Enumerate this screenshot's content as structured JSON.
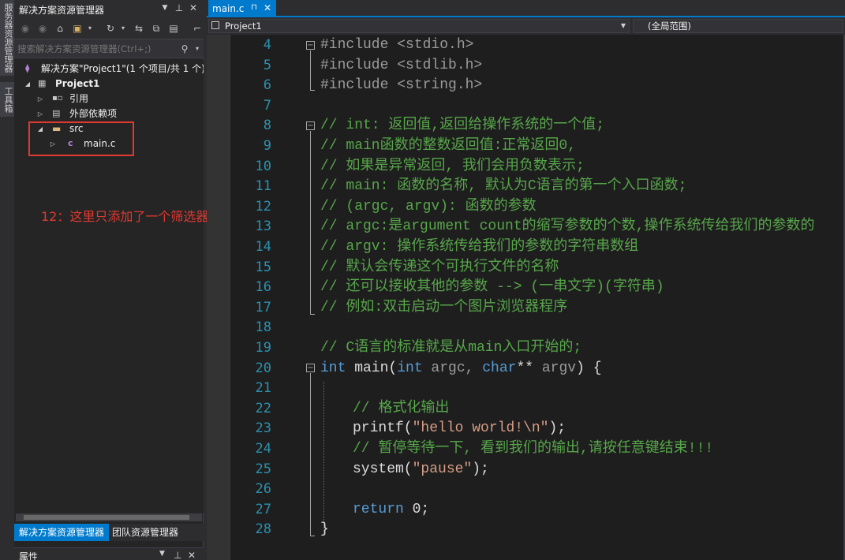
{
  "side_strip": {
    "tab1": "服务器资源管理器",
    "tab2": "工具箱"
  },
  "solution_explorer": {
    "title": "解决方案资源管理器",
    "search_placeholder": "搜索解决方案资源管理器(Ctrl+;)",
    "toolbar_icons": [
      "back-icon",
      "forward-icon",
      "home-icon",
      "switch-views-icon",
      "history-icon",
      "sync-icon",
      "collapse-all-icon",
      "show-all-files-icon",
      "properties-icon"
    ],
    "tree": {
      "solution": "解决方案\"Project1\"(1 个项目/共 1 个)",
      "project": "Project1",
      "references": "引用",
      "external_deps": "外部依赖项",
      "filter": "src",
      "file": "main.c"
    },
    "tabs": [
      "解决方案资源管理器",
      "团队资源管理器"
    ],
    "properties_title": "属性"
  },
  "annotation": {
    "note": "12：这里只添加了一个筛选器",
    "color": "#e0392f"
  },
  "editor": {
    "tab_name": "main.c",
    "pin_glyph": "⊓",
    "nav_project": "Project1",
    "nav_scope": "(全局范围)",
    "line_numbers": [
      "4",
      "5",
      "6",
      "7",
      "8",
      "9",
      "10",
      "11",
      "12",
      "13",
      "14",
      "15",
      "16",
      "17",
      "18",
      "19",
      "20",
      "21",
      "22",
      "23",
      "24",
      "25",
      "26",
      "27",
      "28"
    ],
    "code": {
      "l4": "#include <stdio.h>",
      "l5": "#include <stdlib.h>",
      "l6": "#include <string.h>",
      "l8": "// int: 返回值,返回给操作系统的一个值;",
      "l9": "// main函数的整数返回值:正常返回0,",
      "l10": "// 如果是异常返回, 我们会用负数表示;",
      "l11": "// main: 函数的名称, 默认为C语言的第一个入口函数;",
      "l12": "// (argc, argv): 函数的参数",
      "l13": "// argc:是argument count的缩写参数的个数,操作系统传给我们的参数的",
      "l14": "// argv: 操作系统传给我们的参数的字符串数组",
      "l15": "// 默认会传递这个可执行文件的名称",
      "l16": "// 还可以接收其他的参数 --> (一串文字)(字符串)",
      "l17": "// 例如:双击启动一个图片浏览器程序",
      "l19": "// C语言的标准就是从main入口开始的;",
      "l20_kw1": "int",
      "l20_fn": " main(",
      "l20_kw2": "int",
      "l20_p1": " argc, ",
      "l20_kw3": "char",
      "l20_ptr": "**",
      "l20_p2": " argv",
      "l20_end": ") {",
      "l22": "// 格式化输出",
      "l23_fn": "printf(",
      "l23_str": "\"hello world!\\n\"",
      "l23_end": ");",
      "l24": "// 暂停等待一下, 看到我们的输出,请按任意键结束!!!",
      "l25_fn": "system(",
      "l25_str": "\"pause\"",
      "l25_end": ");",
      "l27_kw": "return",
      "l27_rest": " 0;",
      "l28": "}"
    }
  },
  "colors": {
    "accent": "#007acc",
    "comment": "#57a64a",
    "keyword": "#569cd6",
    "string": "#d69d85",
    "line_number": "#2b91af"
  }
}
